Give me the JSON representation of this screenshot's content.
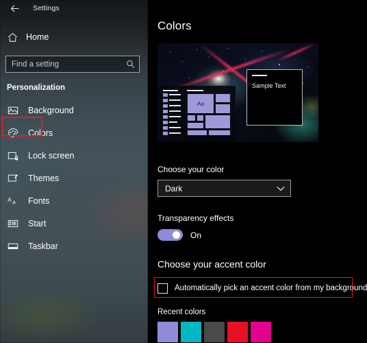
{
  "window": {
    "app_title": "Settings",
    "back_icon": "back-arrow-icon"
  },
  "sidebar": {
    "home": {
      "label": "Home",
      "icon": "home-icon"
    },
    "search": {
      "placeholder": "Find a setting",
      "value": "",
      "icon": "search-icon"
    },
    "section_title": "Personalization",
    "items": [
      {
        "label": "Background",
        "icon": "image-icon",
        "selected": false
      },
      {
        "label": "Colors",
        "icon": "palette-icon",
        "selected": true
      },
      {
        "label": "Lock screen",
        "icon": "lock-screen-icon",
        "selected": false
      },
      {
        "label": "Themes",
        "icon": "themes-icon",
        "selected": false
      },
      {
        "label": "Fonts",
        "icon": "fonts-icon",
        "selected": false
      },
      {
        "label": "Start",
        "icon": "start-icon",
        "selected": false
      },
      {
        "label": "Taskbar",
        "icon": "taskbar-icon",
        "selected": false
      }
    ]
  },
  "main": {
    "page_title": "Colors",
    "preview": {
      "sample_text": "Sample Text",
      "tile_text": "Aa",
      "tile_color": "#9e9ada"
    },
    "choose_color": {
      "label": "Choose your color",
      "value": "Dark",
      "chevron_icon": "chevron-down-icon"
    },
    "transparency": {
      "label": "Transparency effects",
      "state": "On",
      "enabled": true,
      "accent": "#8e8cd8"
    },
    "accent_section": {
      "title": "Choose your accent color",
      "auto_pick_label": "Automatically pick an accent color from my background",
      "auto_pick_checked": false,
      "recent_label": "Recent colors",
      "recent_colors": [
        "#8e8cd8",
        "#00b7c3",
        "#4c4a48",
        "#e81123",
        "#e3008c"
      ]
    }
  },
  "annotations": {
    "highlight_color": "#e02020",
    "highlighted": [
      "sidebar-item-colors",
      "auto-accent-checkbox-row"
    ]
  }
}
